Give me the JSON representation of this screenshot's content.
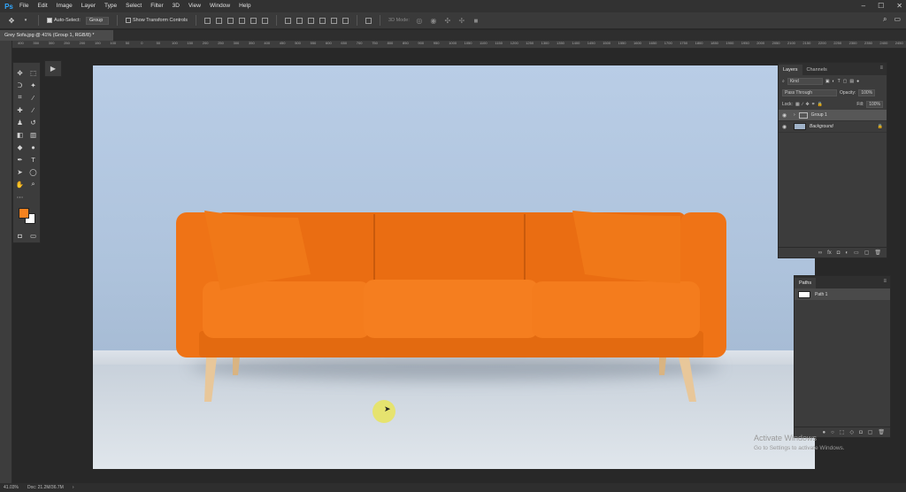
{
  "app": {
    "logo": "Ps"
  },
  "menu": [
    "File",
    "Edit",
    "Image",
    "Layer",
    "Type",
    "Select",
    "Filter",
    "3D",
    "View",
    "Window",
    "Help"
  ],
  "window_controls": [
    "–",
    "☐",
    "✕"
  ],
  "options": {
    "auto_select_label": "Auto-Select:",
    "auto_select_value": "Group",
    "show_transform_label": "Show Transform Controls",
    "mode_3d_label": "3D Mode:"
  },
  "document": {
    "tab_title": "Grey Sofa.jpg @ 41% (Group 1, RGB/8) *"
  },
  "ruler_ticks": [
    "400",
    "350",
    "300",
    "250",
    "200",
    "150",
    "100",
    "50",
    "0",
    "50",
    "100",
    "150",
    "200",
    "250",
    "300",
    "350",
    "400",
    "450",
    "500",
    "550",
    "600",
    "650",
    "700",
    "750",
    "800",
    "850",
    "900",
    "950",
    "1000",
    "1050",
    "1100",
    "1150",
    "1200",
    "1250",
    "1300",
    "1350",
    "1400",
    "1450",
    "1500",
    "1550",
    "1600",
    "1650",
    "1700",
    "1750",
    "1800",
    "1850",
    "1900",
    "1950",
    "2000",
    "2050",
    "2100",
    "2150",
    "2200",
    "2250",
    "2300",
    "2350",
    "2400",
    "2450",
    "2500"
  ],
  "layers_panel": {
    "tabs": [
      "Layers",
      "Channels"
    ],
    "filter_label": "Kind",
    "blend_mode": "Pass Through",
    "opacity_label": "Opacity:",
    "opacity_value": "100%",
    "lock_label": "Lock:",
    "fill_label": "Fill:",
    "fill_value": "100%",
    "layers": [
      {
        "name": "Group 1",
        "type": "group"
      },
      {
        "name": "Background",
        "type": "image"
      }
    ]
  },
  "paths_panel": {
    "title": "Paths",
    "paths": [
      {
        "name": "Path 1"
      }
    ]
  },
  "watermark": {
    "title": "Activate Windows",
    "subtitle": "Go to Settings to activate Windows."
  },
  "status": {
    "zoom": "41.03%",
    "doc": "Doc: 21.2M/36.7M"
  },
  "colors": {
    "foreground": "#f5821f",
    "background": "#ffffff",
    "sofa": "#f07315"
  }
}
